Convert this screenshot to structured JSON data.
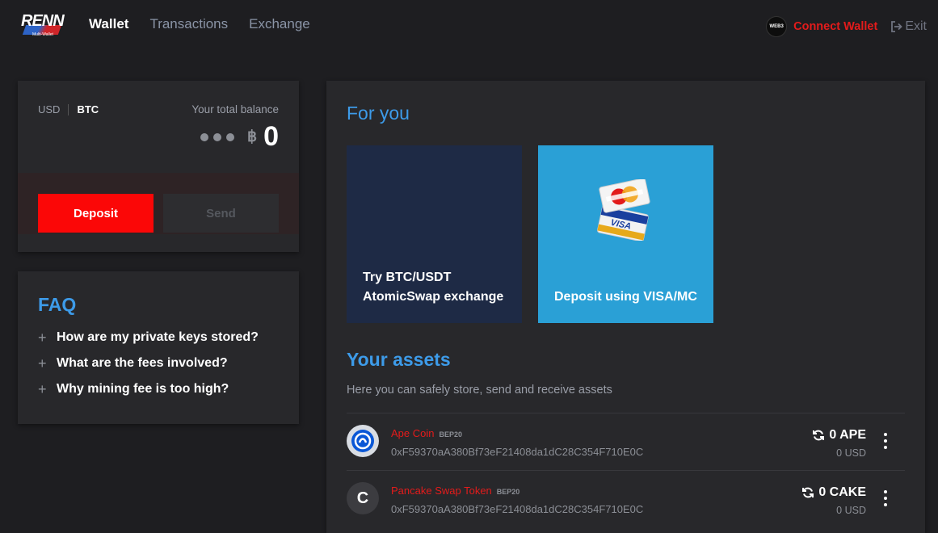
{
  "header": {
    "logo_text": "RENN",
    "logo_sub": "Multi-Wallet",
    "nav": [
      {
        "label": "Wallet",
        "active": true
      },
      {
        "label": "Transactions",
        "active": false
      },
      {
        "label": "Exchange",
        "active": false
      }
    ],
    "web3_badge": "WEB3",
    "connect_label": "Connect Wallet",
    "exit_label": "Exit"
  },
  "balance": {
    "currency_usd": "USD",
    "currency_btc": "BTC",
    "label": "Your total balance",
    "symbol": "฿",
    "value": "0",
    "deposit_label": "Deposit",
    "send_label": "Send"
  },
  "faq": {
    "title": "FAQ",
    "items": [
      "How are my private keys stored?",
      "What are the fees involved?",
      "Why mining fee is too high?"
    ]
  },
  "main": {
    "for_you_title": "For you",
    "promos": [
      "Try BTC/USDT\nAtomicSwap exchange",
      "Deposit using VISA/MC"
    ],
    "assets_title": "Your assets",
    "assets_subtitle": "Here you can safely store, send and receive assets",
    "assets": [
      {
        "name": "Ape Coin",
        "standard": "BEP20",
        "address": "0xF59370aA380Bf73eF21408da1dC28C354F710E0C",
        "balance": "0 APE",
        "usd": "0 USD",
        "icon_letter": ""
      },
      {
        "name": "Pancake Swap Token",
        "standard": "BEP20",
        "address": "0xF59370aA380Bf73eF21408da1dC28C354F710E0C",
        "balance": "0 CAKE",
        "usd": "0 USD",
        "icon_letter": "C"
      }
    ]
  },
  "icons": {
    "exit": "sign-out-icon",
    "refresh": "refresh-icon",
    "more": "vertical-dots-icon",
    "plus": "plus-icon",
    "cards": "credit-cards-icon"
  },
  "colors": {
    "accent_blue": "#3d9be9",
    "accent_red": "#fb0707",
    "background": "#1e1e21",
    "card": "#28282b"
  }
}
